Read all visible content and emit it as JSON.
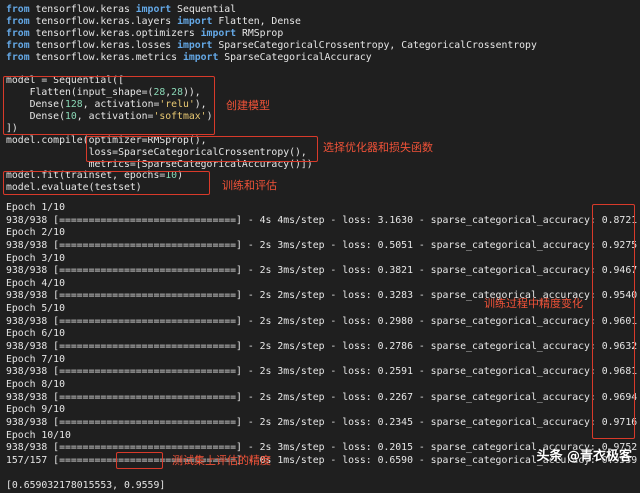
{
  "code": {
    "lines": [
      [
        {
          "t": "from",
          "c": "kw"
        },
        {
          "t": " tensorflow.keras "
        },
        {
          "t": "import",
          "c": "kw"
        },
        {
          "t": " Sequential"
        }
      ],
      [
        {
          "t": "from",
          "c": "kw"
        },
        {
          "t": " tensorflow.keras.layers "
        },
        {
          "t": "import",
          "c": "kw"
        },
        {
          "t": " Flatten, Dense"
        }
      ],
      [
        {
          "t": "from",
          "c": "kw"
        },
        {
          "t": " tensorflow.keras.optimizers "
        },
        {
          "t": "import",
          "c": "kw"
        },
        {
          "t": " RMSprop"
        }
      ],
      [
        {
          "t": "from",
          "c": "kw"
        },
        {
          "t": " tensorflow.keras.losses "
        },
        {
          "t": "import",
          "c": "kw"
        },
        {
          "t": " SparseCategoricalCrossentropy, CategoricalCrossentropy"
        }
      ],
      [
        {
          "t": "from",
          "c": "kw"
        },
        {
          "t": " tensorflow.keras.metrics "
        },
        {
          "t": "import",
          "c": "kw"
        },
        {
          "t": " SparseCategoricalAccuracy"
        }
      ],
      [],
      [
        {
          "t": "model = Sequential(["
        }
      ],
      [
        {
          "t": "    Flatten(input_shape=("
        },
        {
          "t": "28",
          "c": "num"
        },
        {
          "t": ","
        },
        {
          "t": "28",
          "c": "num"
        },
        {
          "t": ")),"
        }
      ],
      [
        {
          "t": "    Dense("
        },
        {
          "t": "128",
          "c": "num"
        },
        {
          "t": ", activation="
        },
        {
          "t": "'relu'",
          "c": "str"
        },
        {
          "t": "),"
        }
      ],
      [
        {
          "t": "    Dense("
        },
        {
          "t": "10",
          "c": "num"
        },
        {
          "t": ", activation="
        },
        {
          "t": "'softmax'",
          "c": "str"
        },
        {
          "t": ")"
        }
      ],
      [
        {
          "t": "])"
        }
      ],
      [
        {
          "t": "model.compile(optimizer=RMSprop(),"
        }
      ],
      [
        {
          "t": "              loss=SparseCategoricalCrossentropy(),"
        }
      ],
      [
        {
          "t": "              metrics=[SparseCategoricalAccuracy()])"
        }
      ],
      [
        {
          "t": "model.fit(trainset, epochs="
        },
        {
          "t": "10",
          "c": "num"
        },
        {
          "t": ")"
        }
      ],
      [
        {
          "t": "model.evaluate(testset)"
        }
      ]
    ]
  },
  "output": {
    "lines": [
      "Epoch 1/10",
      "938/938 [==============================] - 4s 4ms/step - loss: 3.1630 - sparse_categorical_accuracy: 0.8721",
      "Epoch 2/10",
      "938/938 [==============================] - 2s 3ms/step - loss: 0.5051 - sparse_categorical_accuracy: 0.9275",
      "Epoch 3/10",
      "938/938 [==============================] - 2s 3ms/step - loss: 0.3821 - sparse_categorical_accuracy: 0.9467",
      "Epoch 4/10",
      "938/938 [==============================] - 2s 2ms/step - loss: 0.3283 - sparse_categorical_accuracy: 0.9540",
      "Epoch 5/10",
      "938/938 [==============================] - 2s 2ms/step - loss: 0.2980 - sparse_categorical_accuracy: 0.9601",
      "Epoch 6/10",
      "938/938 [==============================] - 2s 2ms/step - loss: 0.2786 - sparse_categorical_accuracy: 0.9632",
      "Epoch 7/10",
      "938/938 [==============================] - 2s 3ms/step - loss: 0.2591 - sparse_categorical_accuracy: 0.9681",
      "Epoch 8/10",
      "938/938 [==============================] - 2s 2ms/step - loss: 0.2267 - sparse_categorical_accuracy: 0.9694",
      "Epoch 9/10",
      "938/938 [==============================] - 2s 2ms/step - loss: 0.2345 - sparse_categorical_accuracy: 0.9716",
      "Epoch 10/10",
      "938/938 [==============================] - 2s 3ms/step - loss: 0.2015 - sparse_categorical_accuracy: 0.9752",
      "157/157 [==============================] - 0s 1ms/step - loss: 0.6590 - sparse_categorical_accuracy: 0.9559",
      "",
      "[0.659032178015553, 0.9559]"
    ]
  },
  "annotations": {
    "create_model": "创建模型",
    "optimizer_loss": "选择优化器和损失函数",
    "train_eval": "训练和评估",
    "accuracy_change": "训练过程中精度变化",
    "test_accuracy": "测试集上评估的精度"
  },
  "watermark": "头条 @青衣极客"
}
